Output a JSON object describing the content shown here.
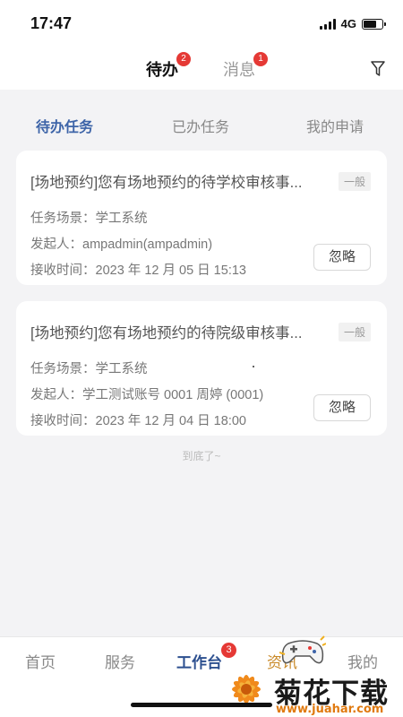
{
  "status_bar": {
    "time": "17:47",
    "network": "4G"
  },
  "top_tabs": [
    {
      "label": "待办",
      "badge": "2",
      "active": true
    },
    {
      "label": "消息",
      "badge": "1",
      "active": false
    }
  ],
  "sub_tabs": [
    {
      "label": "待办任务",
      "active": true
    },
    {
      "label": "已办任务",
      "active": false
    },
    {
      "label": "我的申请",
      "active": false
    }
  ],
  "tasks": [
    {
      "title": "[场地预约]您有场地预约的待学校审核事...",
      "priority": "一般",
      "scene": "任务场景：学工系统",
      "initiator": "发起人：ampadmin(ampadmin)",
      "received": "接收时间：2023 年 12 月 05 日 15:13",
      "ignore_label": "忽略"
    },
    {
      "title": "[场地预约]您有场地预约的待院级审核事...",
      "priority": "一般",
      "scene": "任务场景：学工系统",
      "initiator": "发起人：学工测试账号 0001 周婷 (0001)",
      "received": "接收时间：2023 年 12 月 04 日 18:00",
      "ignore_label": "忽略"
    }
  ],
  "end_text": "到底了~",
  "bottom_nav": [
    {
      "label": "首页",
      "active": false
    },
    {
      "label": "服务",
      "active": false
    },
    {
      "label": "工作台",
      "active": true,
      "badge": "3"
    },
    {
      "label": "资讯",
      "active": false
    },
    {
      "label": "我的",
      "active": false
    }
  ],
  "watermark": {
    "title": "菊花下载网",
    "url": "www.juahar.com"
  },
  "colors": {
    "accent": "#3d64a8",
    "badge": "#e53935",
    "nav_active": "#2c4f8f"
  },
  "icons": {
    "filter": "filter-icon"
  }
}
